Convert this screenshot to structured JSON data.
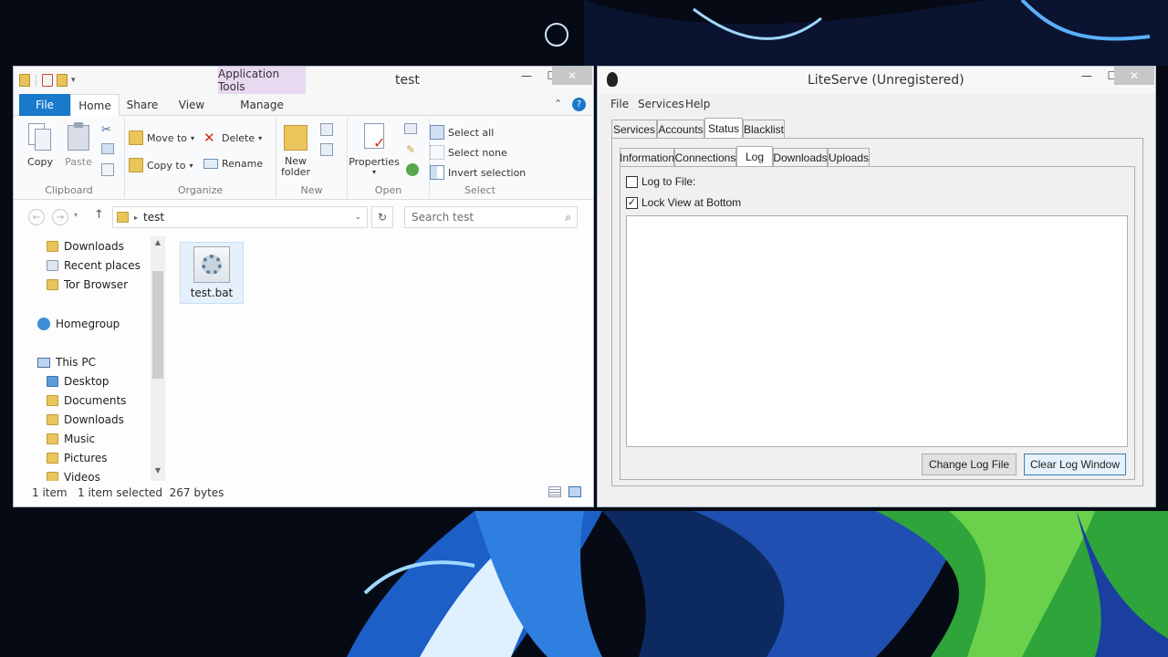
{
  "explorer": {
    "title": "test",
    "context_tab": "Application Tools",
    "tabs": [
      "File",
      "Home",
      "Share",
      "View",
      "Manage"
    ],
    "ribbon": {
      "clipboard": {
        "name": "Clipboard",
        "copy": "Copy",
        "paste": "Paste"
      },
      "organize": {
        "name": "Organize",
        "move_to": "Move to",
        "copy_to": "Copy to",
        "delete": "Delete",
        "rename": "Rename"
      },
      "new": {
        "name": "New",
        "new_folder_line1": "New",
        "new_folder_line2": "folder"
      },
      "open": {
        "name": "Open",
        "properties": "Properties"
      },
      "select": {
        "name": "Select",
        "select_all": "Select all",
        "select_none": "Select none",
        "invert_selection": "Invert selection"
      }
    },
    "address": {
      "path": "test"
    },
    "search": {
      "placeholder": "Search test"
    },
    "nav": {
      "downloads_top": "Downloads",
      "recent_places": "Recent places",
      "tor_browser": "Tor Browser",
      "homegroup": "Homegroup",
      "this_pc": "This PC",
      "desktop": "Desktop",
      "documents": "Documents",
      "downloads": "Downloads",
      "music": "Music",
      "pictures": "Pictures",
      "videos": "Videos"
    },
    "files": [
      {
        "name": "test.bat"
      }
    ],
    "status": {
      "count": "1 item",
      "selection": "1 item selected  267 bytes"
    }
  },
  "liteserve": {
    "title": "LiteServe (Unregistered)",
    "menu": [
      "File",
      "Services",
      "Help"
    ],
    "top_tabs": [
      "Services",
      "Accounts",
      "Status",
      "Blacklist"
    ],
    "sub_tabs": [
      "Information",
      "Connections",
      "Log",
      "Downloads",
      "Uploads"
    ],
    "log_to_file": {
      "label": "Log to File:",
      "checked": false
    },
    "lock_view": {
      "label": "Lock View at Bottom",
      "checked": true
    },
    "buttons": {
      "change_log": "Change Log File",
      "clear_log": "Clear Log Window"
    }
  }
}
